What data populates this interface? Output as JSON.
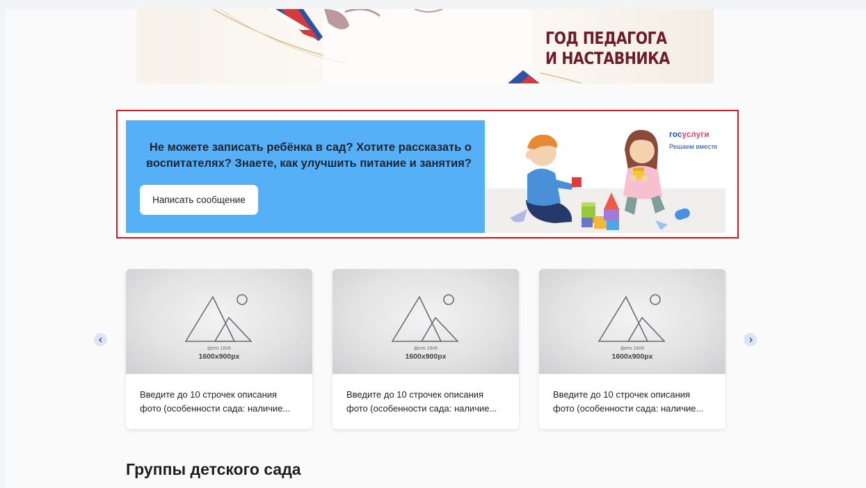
{
  "top_banner": {
    "title_line1": "ГОД ПЕДАГОГА",
    "title_line2": "И НАСТАВНИКА"
  },
  "promo": {
    "text_line1": "Не можете записать ребёнка в сад? Хотите рассказать о",
    "text_line2": "воспитателях? Знаете, как улучшить питание и занятия?",
    "button_label": "Написать сообщение",
    "logo_part1": "гос",
    "logo_part2": "услуги",
    "logo_subtitle": "Решаем вместе",
    "colors": {
      "blue": "#55b0f8",
      "frame": "#e0141b"
    }
  },
  "carousel": {
    "prev_icon": "chevron-left-icon",
    "next_icon": "chevron-right-icon",
    "cards": [
      {
        "ph_small": "фото 16х9",
        "ph_big": "1600x900px",
        "desc_line1": "Введите до 10 строчек описания",
        "desc_line2": "фото (особенности сада: наличие..."
      },
      {
        "ph_small": "фото 16х9",
        "ph_big": "1600x900px",
        "desc_line1": "Введите до 10 строчек описания",
        "desc_line2": "фото (особенности сада: наличие..."
      },
      {
        "ph_small": "фото 16х9",
        "ph_big": "1600x900px",
        "desc_line1": "Введите до 10 строчек описания",
        "desc_line2": "фото (особенности сада: наличие..."
      }
    ]
  },
  "section_title": "Группы детского сада"
}
